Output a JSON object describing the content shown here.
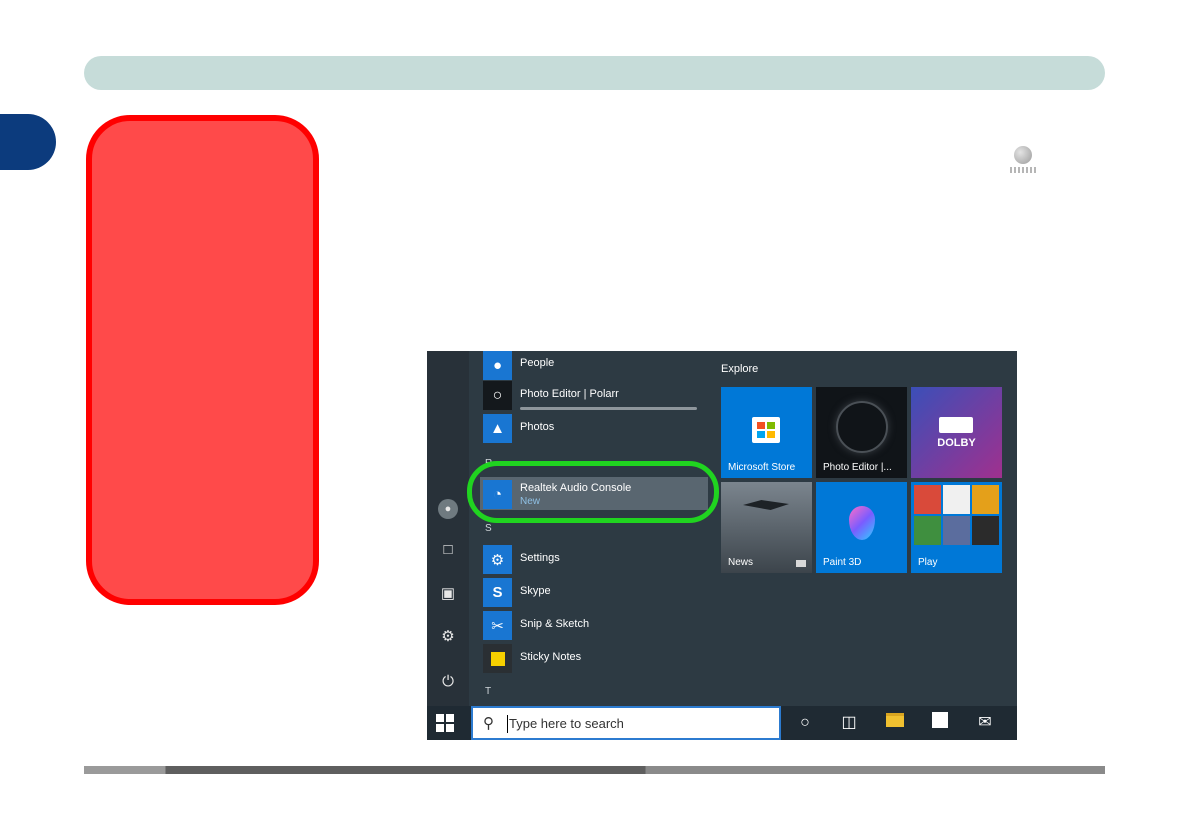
{
  "start_menu": {
    "apps": [
      {
        "name": "People"
      },
      {
        "name": "Photo Editor | Polarr"
      },
      {
        "name": "Photos"
      },
      {
        "name": "Realtek Audio Console",
        "badge": "New"
      },
      {
        "name": "Settings"
      },
      {
        "name": "Skype"
      },
      {
        "name": "Snip & Sketch"
      },
      {
        "name": "Sticky Notes"
      }
    ],
    "letters": {
      "r": "R",
      "s": "S",
      "t": "T"
    },
    "group_title": "Explore",
    "tiles": [
      {
        "label": "Microsoft Store",
        "color": "#0078d7"
      },
      {
        "label": "Photo Editor |...",
        "color": "#101418"
      },
      {
        "label": "",
        "text": "DOLBY",
        "color": "#7a3aa8"
      },
      {
        "label": "News",
        "color": "#596470"
      },
      {
        "label": "Paint 3D",
        "color": "#0078d7"
      },
      {
        "label": "Play",
        "color": "#0078d7"
      }
    ],
    "search_placeholder": "Type here to search"
  },
  "colors": {
    "header": "#c6dcd9",
    "chapter_tab": "#0c3b7d",
    "callout_fill": "#ff4a4a",
    "callout_border": "#ff0000",
    "highlight_ring": "#20d420"
  }
}
